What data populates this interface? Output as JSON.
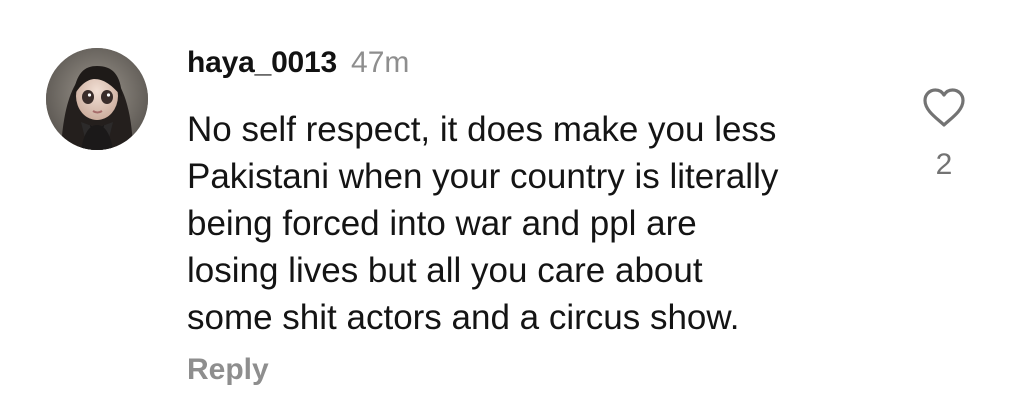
{
  "comment": {
    "username": "haya_0013",
    "timestamp": "47m",
    "text": "No self respect, it does make you less\nPakistani when your country is literally\nbeing forced into war and ppl are\nlosing lives but all you care about\nsome shit actors and a circus show.",
    "reply_label": "Reply",
    "like_count": "2",
    "like_icon": "heart-outline-icon",
    "avatar_icon": "profile-avatar"
  },
  "colors": {
    "text_primary": "#141414",
    "text_secondary": "#8e8e8e",
    "icon": "#737373",
    "background": "#ffffff"
  }
}
